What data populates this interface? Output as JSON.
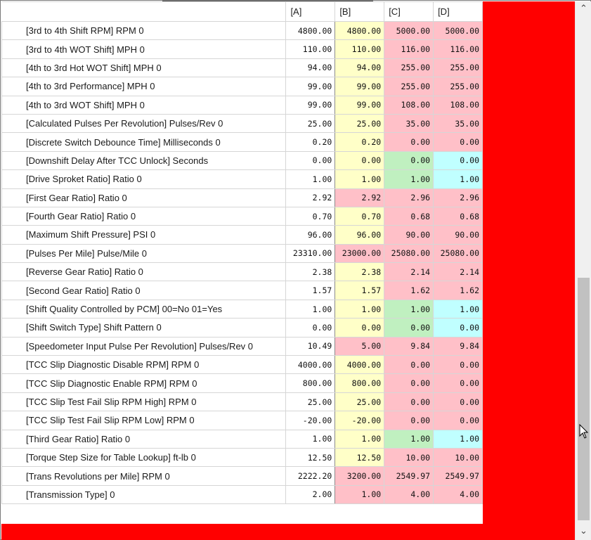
{
  "columns": [
    "[A]",
    "[B]",
    "[C]",
    "[D]"
  ],
  "rows": [
    {
      "name": "[3rd to 4th Shift RPM] RPM 0",
      "a": "4800.00",
      "b": "4800.00",
      "c": "5000.00",
      "d": "5000.00",
      "cb": "y",
      "cc": "p",
      "cd": "p"
    },
    {
      "name": "[3rd to 4th WOT Shift] MPH 0",
      "a": "110.00",
      "b": "110.00",
      "c": "116.00",
      "d": "116.00",
      "cb": "y",
      "cc": "p",
      "cd": "p"
    },
    {
      "name": "[4th to 3rd Hot WOT Shift] MPH 0",
      "a": "94.00",
      "b": "94.00",
      "c": "255.00",
      "d": "255.00",
      "cb": "y",
      "cc": "p",
      "cd": "p"
    },
    {
      "name": "[4th to 3rd Performance] MPH 0",
      "a": "99.00",
      "b": "99.00",
      "c": "255.00",
      "d": "255.00",
      "cb": "y",
      "cc": "p",
      "cd": "p"
    },
    {
      "name": "[4th to 3rd WOT Shift] MPH 0",
      "a": "99.00",
      "b": "99.00",
      "c": "108.00",
      "d": "108.00",
      "cb": "y",
      "cc": "p",
      "cd": "p"
    },
    {
      "name": "[Calculated Pulses Per Revolution] Pulses/Rev 0",
      "a": "25.00",
      "b": "25.00",
      "c": "35.00",
      "d": "35.00",
      "cb": "y",
      "cc": "p",
      "cd": "p"
    },
    {
      "name": "[Discrete Switch Debounce Time] Milliseconds 0",
      "a": "0.20",
      "b": "0.20",
      "c": "0.00",
      "d": "0.00",
      "cb": "y",
      "cc": "p",
      "cd": "p"
    },
    {
      "name": "[Downshift Delay After TCC Unlock] Seconds",
      "a": "0.00",
      "b": "0.00",
      "c": "0.00",
      "d": "0.00",
      "cb": "y",
      "cc": "g",
      "cd": "c"
    },
    {
      "name": "[Drive Sproket Ratio] Ratio 0",
      "a": "1.00",
      "b": "1.00",
      "c": "1.00",
      "d": "1.00",
      "cb": "y",
      "cc": "g",
      "cd": "c"
    },
    {
      "name": "[First Gear Ratio] Ratio 0",
      "a": "2.92",
      "b": "2.92",
      "c": "2.96",
      "d": "2.96",
      "cb": "p",
      "cc": "p",
      "cd": "p"
    },
    {
      "name": "[Fourth Gear Ratio] Ratio 0",
      "a": "0.70",
      "b": "0.70",
      "c": "0.68",
      "d": "0.68",
      "cb": "y",
      "cc": "p",
      "cd": "p"
    },
    {
      "name": "[Maximum Shift Pressure] PSI 0",
      "a": "96.00",
      "b": "96.00",
      "c": "90.00",
      "d": "90.00",
      "cb": "y",
      "cc": "p",
      "cd": "p"
    },
    {
      "name": "[Pulses Per Mile] Pulse/Mile 0",
      "a": "23310.00",
      "b": "23000.00",
      "c": "25080.00",
      "d": "25080.00",
      "cb": "p",
      "cc": "p",
      "cd": "p"
    },
    {
      "name": "[Reverse Gear Ratio] Ratio 0",
      "a": "2.38",
      "b": "2.38",
      "c": "2.14",
      "d": "2.14",
      "cb": "y",
      "cc": "p",
      "cd": "p"
    },
    {
      "name": "[Second Gear Ratio] Ratio 0",
      "a": "1.57",
      "b": "1.57",
      "c": "1.62",
      "d": "1.62",
      "cb": "y",
      "cc": "p",
      "cd": "p"
    },
    {
      "name": "[Shift Quality Controlled by PCM] 00=No 01=Yes",
      "a": "1.00",
      "b": "1.00",
      "c": "1.00",
      "d": "1.00",
      "cb": "y",
      "cc": "g",
      "cd": "c"
    },
    {
      "name": "[Shift Switch Type] Shift Pattern 0",
      "a": "0.00",
      "b": "0.00",
      "c": "0.00",
      "d": "0.00",
      "cb": "y",
      "cc": "g",
      "cd": "c"
    },
    {
      "name": "[Speedometer Input Pulse Per Revolution] Pulses/Rev 0",
      "a": "10.49",
      "b": "5.00",
      "c": "9.84",
      "d": "9.84",
      "cb": "p",
      "cc": "p",
      "cd": "p"
    },
    {
      "name": "[TCC Slip Diagnostic Disable RPM] RPM 0",
      "a": "4000.00",
      "b": "4000.00",
      "c": "0.00",
      "d": "0.00",
      "cb": "y",
      "cc": "p",
      "cd": "p"
    },
    {
      "name": "[TCC Slip Diagnostic Enable RPM] RPM 0",
      "a": "800.00",
      "b": "800.00",
      "c": "0.00",
      "d": "0.00",
      "cb": "y",
      "cc": "p",
      "cd": "p"
    },
    {
      "name": "[TCC Slip Test Fail Slip RPM High] RPM 0",
      "a": "25.00",
      "b": "25.00",
      "c": "0.00",
      "d": "0.00",
      "cb": "y",
      "cc": "p",
      "cd": "p"
    },
    {
      "name": "[TCC Slip Test Fail Slip RPM Low] RPM 0",
      "a": "-20.00",
      "b": "-20.00",
      "c": "0.00",
      "d": "0.00",
      "cb": "y",
      "cc": "p",
      "cd": "p"
    },
    {
      "name": "[Third Gear Ratio] Ratio 0",
      "a": "1.00",
      "b": "1.00",
      "c": "1.00",
      "d": "1.00",
      "cb": "y",
      "cc": "g",
      "cd": "c"
    },
    {
      "name": "[Torque Step Size for Table Lookup] ft-lb 0",
      "a": "12.50",
      "b": "12.50",
      "c": "10.00",
      "d": "10.00",
      "cb": "y",
      "cc": "p",
      "cd": "p"
    },
    {
      "name": "[Trans Revolutions per Mile] RPM 0",
      "a": "2222.20",
      "b": "3200.00",
      "c": "2549.97",
      "d": "2549.97",
      "cb": "p",
      "cc": "p",
      "cd": "p"
    },
    {
      "name": "[Transmission Type]  0",
      "a": "2.00",
      "b": "1.00",
      "c": "4.00",
      "d": "4.00",
      "cb": "p",
      "cc": "p",
      "cd": "p"
    }
  ],
  "colors": {
    "y": "#ffffc8",
    "p": "#ffc0c8",
    "g": "#c0f0c0",
    "c": "#c0ffff",
    "background_red": "#ff0000"
  },
  "scrollbar": {
    "up_icon": "chevron-up-icon",
    "down_icon": "chevron-down-icon",
    "up_glyph": "⌃",
    "down_glyph": "⌄"
  }
}
